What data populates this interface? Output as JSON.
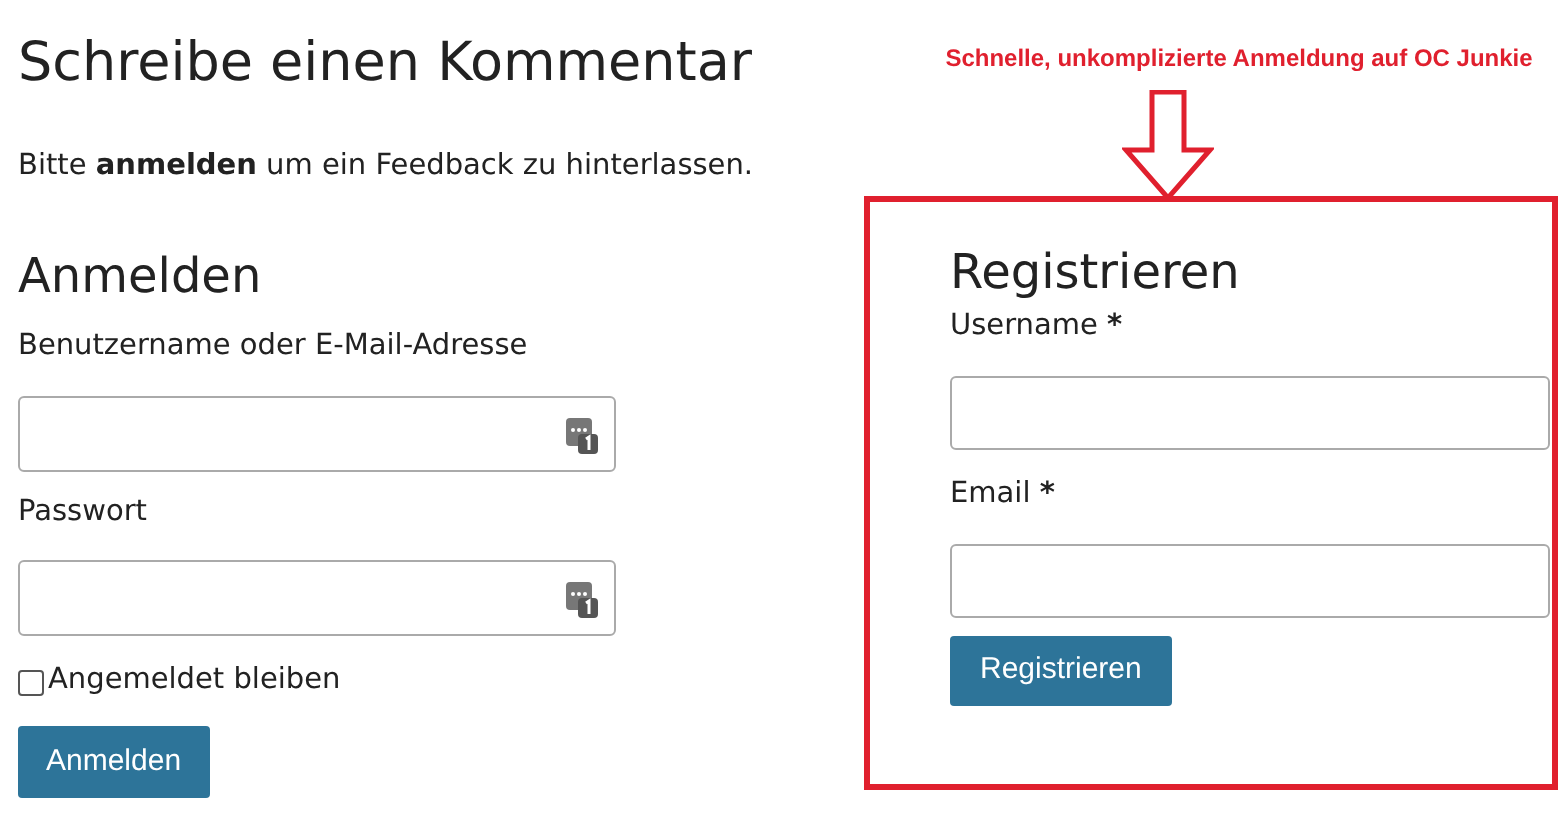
{
  "heading": "Schreibe einen Kommentar",
  "intro": "Bitte **anmelden** um ein Feedback zu hinterlassen.",
  "annotation": "Schnelle, unkomplizierte Anmeldung auf OC Junkie",
  "login": {
    "title": "Anmelden",
    "fields": [
      {
        "label": "Benutzername oder E-Mail-Adresse"
      },
      {
        "label": "Passwort"
      }
    ],
    "remember": {
      "label": "Angemeldet bleiben",
      "checked": false
    },
    "button": "Anmelden"
  },
  "register": {
    "title": "Registrieren",
    "fields": [
      {
        "label": "Username",
        "required_mark": "*"
      },
      {
        "label": "Email",
        "required_mark": "*"
      }
    ],
    "button": "Registrieren"
  }
}
